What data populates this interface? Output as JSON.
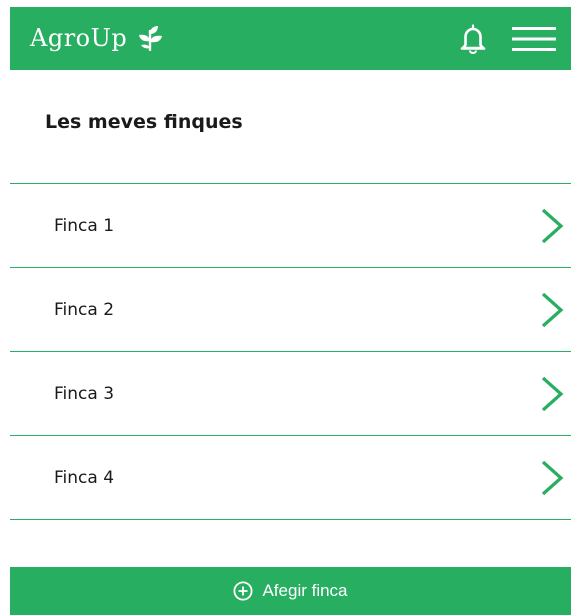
{
  "header": {
    "brand": "AgroUp",
    "brand_icon": "leaf-icon",
    "notification_icon": "bell-icon",
    "menu_icon": "hamburger-menu-icon",
    "accent_color": "#27ae60"
  },
  "page": {
    "title": "Les meves finques"
  },
  "farms": [
    {
      "label": "Finca 1",
      "icon": "chevron-right-icon"
    },
    {
      "label": "Finca 2",
      "icon": "chevron-right-icon"
    },
    {
      "label": "Finca 3",
      "icon": "chevron-right-icon"
    },
    {
      "label": "Finca 4",
      "icon": "chevron-right-icon"
    }
  ],
  "actions": {
    "add_farm_label": "Afegir finca",
    "add_farm_icon": "plus-circle-icon"
  }
}
